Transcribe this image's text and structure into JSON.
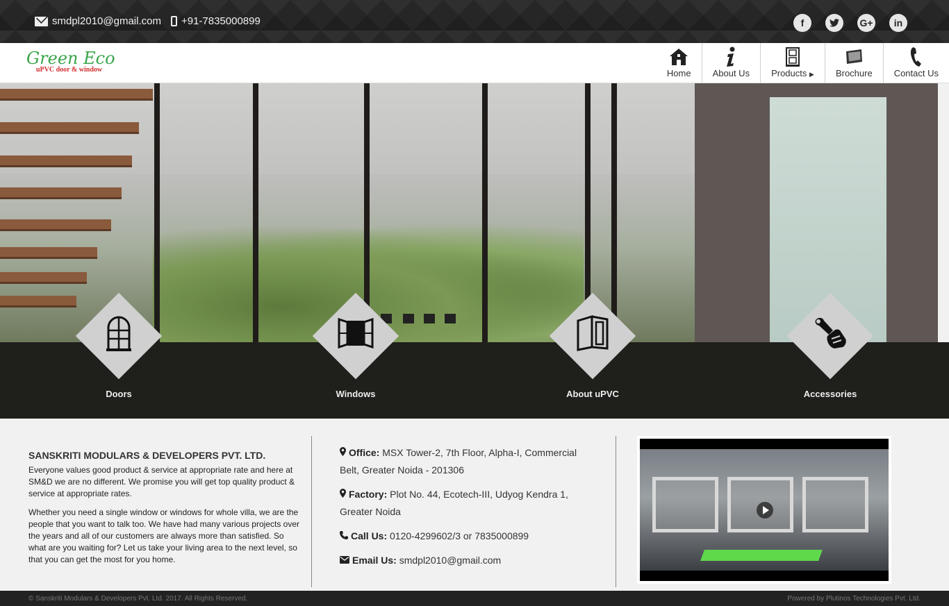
{
  "topbar": {
    "email": "smdpl2010@gmail.com",
    "phone": "+91-7835000899",
    "socials": [
      {
        "name": "facebook",
        "glyph": "f"
      },
      {
        "name": "twitter",
        "glyph": "t"
      },
      {
        "name": "google-plus",
        "glyph": "G+"
      },
      {
        "name": "linkedin",
        "glyph": "in"
      }
    ]
  },
  "brand": {
    "logo_main": "Green Eco",
    "logo_sub": "uPVC door & window"
  },
  "nav": {
    "items": [
      {
        "label": "Home",
        "icon": "home-icon"
      },
      {
        "label": "About Us",
        "icon": "info-icon"
      },
      {
        "label": "Products",
        "icon": "door-icon"
      },
      {
        "label": "Brochure",
        "icon": "tablet-icon"
      },
      {
        "label": "Contact Us",
        "icon": "phone-handset-icon"
      }
    ]
  },
  "categories": [
    {
      "label": "Doors",
      "icon": "arched-door-icon"
    },
    {
      "label": "Windows",
      "icon": "open-window-icon"
    },
    {
      "label": "About uPVC",
      "icon": "upvc-frame-icon"
    },
    {
      "label": "Accessories",
      "icon": "wrench-hand-icon"
    }
  ],
  "company": {
    "name": "SANSKRITI MODULARS & DEVELOPERS PVT. LTD.",
    "para1": "Everyone values good product & service at appropriate rate and here at SM&D we are no different. We promise you will get top quality product & service at appropriate rates.",
    "para2": "Whether you need a single window or windows for whole villa, we are the people that you want to talk too. We have had many various projects over the years and all of our customers are always more than satisfied. So what are you waiting for? Let us take your living area to the next level, so that you can get the most for you home."
  },
  "contact": {
    "office_label": "Office:",
    "office_value": "MSX Tower-2, 7th Floor, Alpha-I, Commercial Belt, Greater Noida - 201306",
    "factory_label": "Factory:",
    "factory_value": "Plot No. 44, Ecotech-III, Udyog Kendra 1, Greater Noida",
    "call_label": "Call Us:",
    "call_value": "0120-4299602/3 or 7835000899",
    "email_label": "Email Us:",
    "email_value": "smdpl2010@gmail.com"
  },
  "footer": {
    "copyright": "© Sanskriti Modulars & Developers Pvt. Ltd. 2017. All Rights Reserved.",
    "powered": "Powered by Plutinos Technologies Pvt. Ltd."
  },
  "colors": {
    "topbar_bg": "#262626",
    "band_bg": "#1f1f1c",
    "diamond": "#d0d0d0",
    "logo_green": "#3aa54a",
    "logo_red": "#d32f2f"
  }
}
